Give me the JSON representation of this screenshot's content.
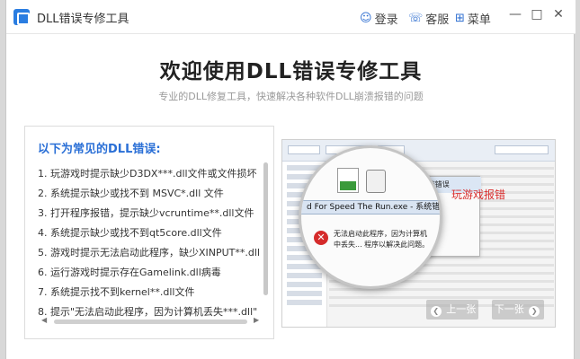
{
  "app": {
    "title": "DLL错误专修工具"
  },
  "titlebar": {
    "login_label": "登录",
    "service_label": "客服",
    "menu_label": "菜单"
  },
  "hero": {
    "title": "欢迎使用DLL错误专修工具",
    "subtitle": "专业的DLL修复工具，快速解决各种软件DLL崩溃报错的问题"
  },
  "panel": {
    "title": "以下为常见的DLL错误:",
    "items": [
      "1. 玩游戏时提示缺少D3DX***.dll文件或文件损坏",
      "2. 系统提示缺少或找不到 MSVC*.dll 文件",
      "3. 打开程序报错，提示缺少vcruntime**.dll文件",
      "4. 系统提示缺少或找不到qt5core.dll文件",
      "5. 游戏时提示无法启动此程序，缺少XINPUT**.dll",
      "6. 运行游戏时提示存在Gamelink.dll病毒",
      "7. 系统提示找不到kernel**.dll文件",
      "8. 提示\"无法启动此程序，因为计算机丢失***.dll\""
    ]
  },
  "screenshot": {
    "label": "玩游戏报错",
    "dialog_title": "d For Speed The Run.exe - 系统错误",
    "error_text": "无法启动此程序，因为计算机中丢失... 程序以解决此问题。",
    "prev_label": "上一张",
    "next_label": "下一张"
  },
  "colors": {
    "accent": "#2a6fd6",
    "error": "#d52b2b",
    "highlight_text": "#d92f2f"
  }
}
